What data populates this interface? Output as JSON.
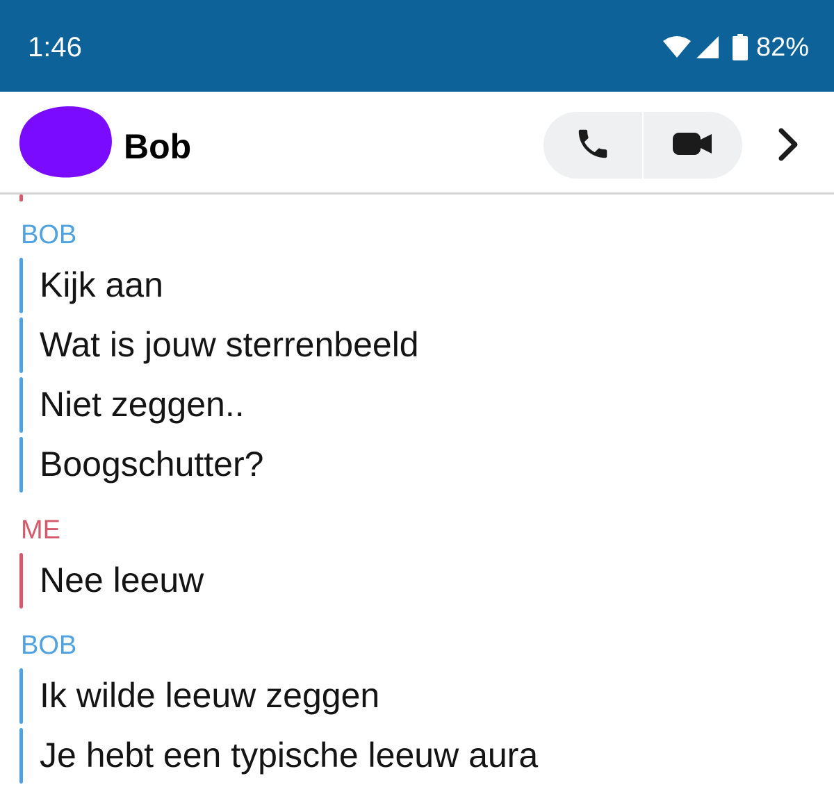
{
  "status_bar": {
    "time": "1:46",
    "battery_percent": "82%",
    "icons": [
      "wifi-icon",
      "cell-signal-icon",
      "battery-icon"
    ]
  },
  "header": {
    "contact_name": "Bob",
    "avatar_color": "#7a0bff",
    "actions": [
      "phone-icon",
      "video-camera-icon",
      "chevron-right-icon"
    ]
  },
  "thread": {
    "groups": [
      {
        "sender": "BOB",
        "messages": [
          "Kijk aan",
          "Wat is jouw sterrenbeeld",
          "Niet zeggen..",
          "Boogschutter?"
        ]
      },
      {
        "sender": "ME",
        "messages": [
          "Nee leeuw"
        ]
      },
      {
        "sender": "BOB",
        "messages": [
          "Ik wilde leeuw zeggen",
          "Je hebt een typische leeuw aura"
        ]
      }
    ]
  },
  "colors": {
    "status_bar": "#0d6299",
    "bob_accent": "#4fa2e1",
    "me_accent": "#d4596a",
    "call_group_bg": "#eef0f1"
  }
}
